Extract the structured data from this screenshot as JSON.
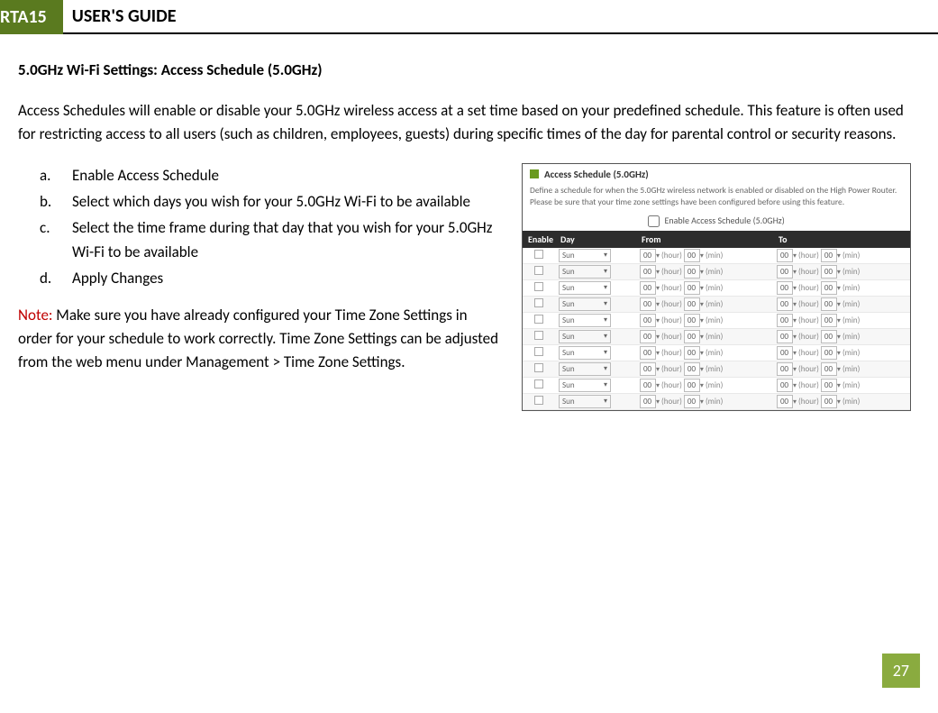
{
  "header": {
    "badge": "RTA15",
    "title": "USER'S GUIDE"
  },
  "section_title": "5.0GHz Wi-Fi Settings: Access Schedule (5.0GHz)",
  "intro": "Access Schedules will enable or disable your 5.0GHz wireless access at a set time based on your predefined schedule.  This feature is often used for restricting access to all users (such as children, employees, guests) during specific times of the day for parental control or security reasons.",
  "steps": [
    {
      "marker": "a.",
      "text": "Enable Access Schedule"
    },
    {
      "marker": "b.",
      "text": "Select which days you wish for your 5.0GHz Wi-Fi to be available"
    },
    {
      "marker": "c.",
      "text": "Select the time frame during that day that you wish for your 5.0GHz Wi-Fi to be available"
    },
    {
      "marker": "d.",
      "text": "Apply Changes"
    }
  ],
  "note_label": "Note:",
  "note_text": "  Make sure you have already configured your Time Zone Settings in order for your schedule to work correctly.  Time Zone Settings can be adjusted from the web menu under Management > Time Zone Settings.",
  "screenshot": {
    "title": "Access Schedule (5.0GHz)",
    "desc": "Define a schedule for when the 5.0GHz wireless network is enabled or disabled on the High Power Router. Please be sure that your time zone settings have been configured before using this feature.",
    "enable_label": "Enable Access Schedule (5.0GHz)",
    "headers": {
      "enable": "Enable",
      "day": "Day",
      "from": "From",
      "to": "To"
    },
    "row": {
      "day": "Sun",
      "hh": "00",
      "mm": "00",
      "hour": "(hour)",
      "min": "(min)"
    },
    "row_count": 10
  },
  "page_number": "27"
}
